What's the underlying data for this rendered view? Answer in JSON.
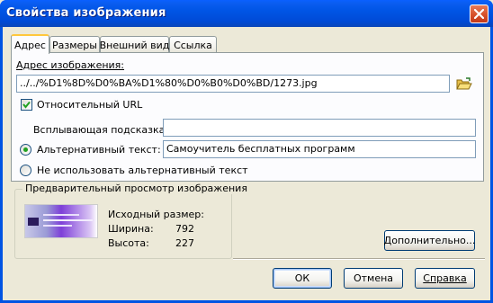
{
  "window": {
    "title": "Свойства изображения"
  },
  "tabs": [
    {
      "label": "Адрес",
      "active": true
    },
    {
      "label": "Размеры",
      "active": false
    },
    {
      "label": "Внешний вид",
      "active": false
    },
    {
      "label": "Ссылка",
      "active": false
    }
  ],
  "address": {
    "label": "Адрес изображения:",
    "value": "../../%D1%8D%D0%BA%D1%80%D0%B0%D0%BD/1273.jpg",
    "browse_icon": "folder-open-icon"
  },
  "relative_url": {
    "label": "Относительный URL",
    "checked": true
  },
  "tooltip": {
    "label": "Всплывающая подсказка:",
    "value": ""
  },
  "alt_text": {
    "label": "Альтернативный текст:",
    "value": "Самоучитель бесплатных программ",
    "selected": true
  },
  "no_alt": {
    "label": "Не использовать альтернативный текст",
    "selected": false
  },
  "preview": {
    "title": "Предварительный просмотр изображения",
    "original_size_label": "Исходный размер:",
    "width_label": "Ширина:",
    "width_value": "792",
    "height_label": "Высота:",
    "height_value": "227"
  },
  "buttons": {
    "more": "Дополнительно...",
    "ok": "ОК",
    "cancel": "Отмена",
    "help": "Справка"
  },
  "colors": {
    "titlebar": "#0054e3",
    "dialog_bg": "#ece9d8",
    "close": "#d6502a",
    "radio_dot": "#21a121"
  }
}
